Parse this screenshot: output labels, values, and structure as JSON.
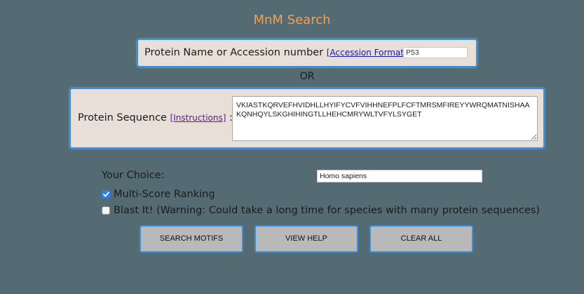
{
  "header": {
    "title": "MnM Search"
  },
  "name_panel": {
    "label": "Protein Name or Accession number",
    "link": "[Accession Format]",
    "colon": ":",
    "input_value": "P53"
  },
  "separator": {
    "text": "OR"
  },
  "sequence_panel": {
    "label": "Protein Sequence",
    "link": "[Instructions]",
    "colon": ":",
    "value": "VKIASTKQRVEFHVIDHLLHYIFYCVFVIHHNEFPLFCFTMRSMFIREYYWRQMATNISHAAKQNHQYLSKGHIHINGTLLHEHCMRYWLTVFYLSYGET"
  },
  "choice": {
    "label": "Your Choice:",
    "species_value": "Homo sapiens"
  },
  "options": [
    {
      "label": "Multi-Score Ranking",
      "checked": true
    },
    {
      "label": "Blast It! (Warning: Could take a long time for species with many protein sequences)",
      "checked": false
    }
  ],
  "buttons": {
    "search": "SEARCH MOTIFS",
    "help": "VIEW HELP",
    "clear": "CLEAR ALL"
  },
  "colors": {
    "background": "#546b74",
    "title": "#f3a04e",
    "panel": "#e8dfd9",
    "focus_border": "#3e8fe0",
    "button": "#b9b9b9"
  }
}
